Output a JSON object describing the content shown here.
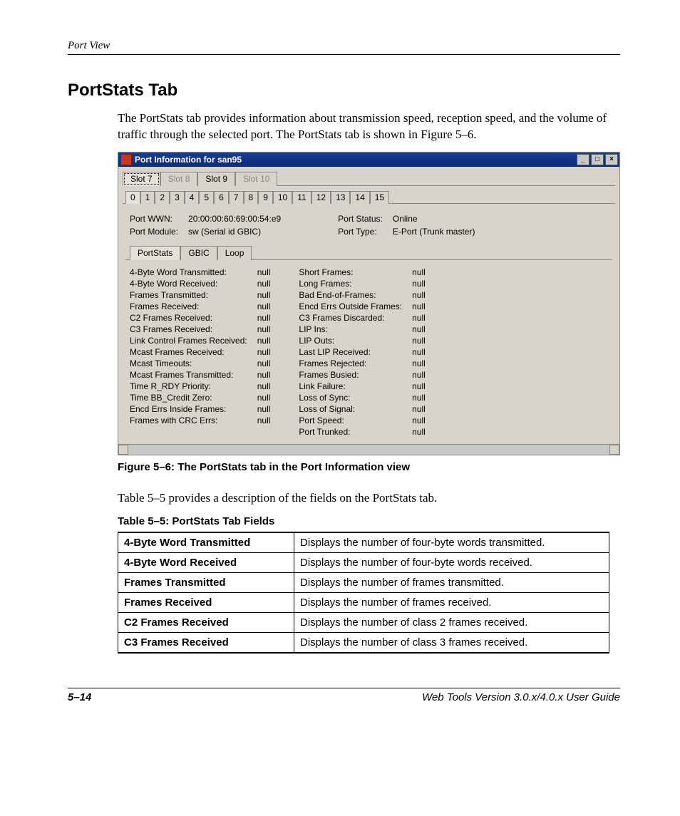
{
  "running_head": "Port View",
  "heading": "PortStats Tab",
  "para1": "The PortStats tab provides information about transmission speed, reception speed, and the volume of traffic through the selected port. The PortStats tab is shown in Figure 5–6.",
  "window": {
    "title": "Port Information for san95",
    "min": "_",
    "max": "□",
    "close": "×",
    "slot_tabs": [
      {
        "label": "Slot 7",
        "state": "active"
      },
      {
        "label": "Slot 8",
        "state": "disabled"
      },
      {
        "label": "Slot 9",
        "state": "enabled"
      },
      {
        "label": "Slot 10",
        "state": "disabled"
      }
    ],
    "port_tabs": [
      "0",
      "1",
      "2",
      "3",
      "4",
      "5",
      "6",
      "7",
      "8",
      "9",
      "10",
      "11",
      "12",
      "13",
      "14",
      "15"
    ],
    "info_left": [
      {
        "k": "Port WWN:",
        "v": "20:00:00:60:69:00:54:e9"
      },
      {
        "k": "Port Module:",
        "v": "sw (Serial id GBIC)"
      }
    ],
    "info_right": [
      {
        "k": "Port Status:",
        "v": "Online"
      },
      {
        "k": "Port Type:",
        "v": "E-Port (Trunk master)"
      }
    ],
    "sub_tabs": [
      {
        "label": "PortStats",
        "active": true
      },
      {
        "label": "GBIC",
        "active": false
      },
      {
        "label": "Loop",
        "active": false
      }
    ],
    "stats_left": [
      {
        "k": "4-Byte Word Transmitted:",
        "v": "null"
      },
      {
        "k": "4-Byte Word Received:",
        "v": "null"
      },
      {
        "k": "Frames Transmitted:",
        "v": "null"
      },
      {
        "k": "Frames Received:",
        "v": "null"
      },
      {
        "k": "C2 Frames Received:",
        "v": "null"
      },
      {
        "k": "C3 Frames Received:",
        "v": "null"
      },
      {
        "k": "Link Control Frames Received:",
        "v": "null"
      },
      {
        "k": "Mcast Frames Received:",
        "v": "null"
      },
      {
        "k": "Mcast Timeouts:",
        "v": "null"
      },
      {
        "k": "Mcast Frames Transmitted:",
        "v": "null"
      },
      {
        "k": "Time R_RDY Priority:",
        "v": "null"
      },
      {
        "k": "Time BB_Credit Zero:",
        "v": "null"
      },
      {
        "k": "Encd Errs Inside Frames:",
        "v": "null"
      },
      {
        "k": "Frames with CRC Errs:",
        "v": "null"
      }
    ],
    "stats_right": [
      {
        "k": "Short Frames:",
        "v": "null"
      },
      {
        "k": "Long Frames:",
        "v": "null"
      },
      {
        "k": "Bad End-of-Frames:",
        "v": "null"
      },
      {
        "k": "Encd Errs Outside Frames:",
        "v": "null"
      },
      {
        "k": "C3 Frames Discarded:",
        "v": "null"
      },
      {
        "k": "LIP Ins:",
        "v": "null"
      },
      {
        "k": "LIP Outs:",
        "v": "null"
      },
      {
        "k": "Last LIP Received:",
        "v": "null"
      },
      {
        "k": "Frames Rejected:",
        "v": "null"
      },
      {
        "k": "Frames Busied:",
        "v": "null"
      },
      {
        "k": "Link Failure:",
        "v": "null"
      },
      {
        "k": "Loss of Sync:",
        "v": "null"
      },
      {
        "k": "Loss of Signal:",
        "v": "null"
      },
      {
        "k": "Port Speed:",
        "v": "null"
      },
      {
        "k": "Port Trunked:",
        "v": "null"
      }
    ]
  },
  "fig_caption": "Figure 5–6:  The PortStats tab in the Port Information view",
  "para2": "Table 5–5 provides a description of the fields on the PortStats tab.",
  "table_caption": "Table 5–5:  PortStats Tab Fields",
  "table_rows": [
    {
      "k": "4-Byte Word Transmitted",
      "v": "Displays the number of four-byte words transmitted."
    },
    {
      "k": "4-Byte Word Received",
      "v": "Displays the number of four-byte words received."
    },
    {
      "k": "Frames Transmitted",
      "v": "Displays the number of frames transmitted."
    },
    {
      "k": "Frames Received",
      "v": "Displays the number of frames received."
    },
    {
      "k": "C2 Frames Received",
      "v": "Displays the number of class 2 frames received."
    },
    {
      "k": "C3 Frames Received",
      "v": "Displays the number of class 3 frames received."
    }
  ],
  "footer": {
    "page": "5–14",
    "book": "Web Tools Version 3.0.x/4.0.x User Guide"
  }
}
